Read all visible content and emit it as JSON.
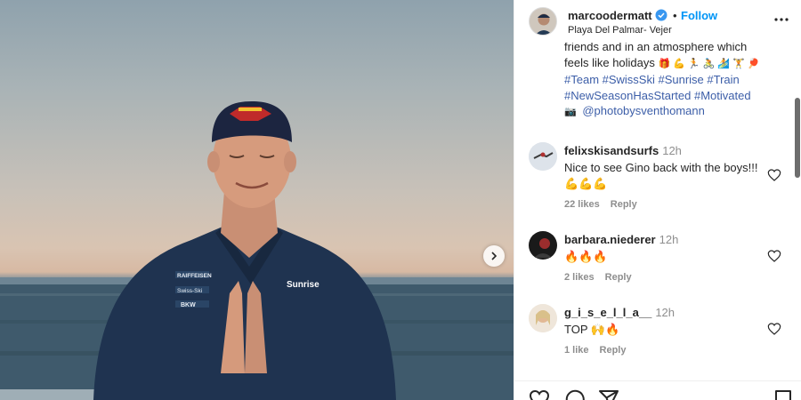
{
  "post": {
    "username": "marcoodermatt",
    "location": "Playa Del Palmar- Vejer",
    "follow_label": "Follow",
    "separator": "•",
    "caption_lines": [
      "friends and in an atmosphere which",
      "feels like holidays"
    ],
    "caption_emojis": [
      "🎁",
      "💪",
      "🏃",
      "🚴",
      "🏄",
      "🏋",
      "🏓"
    ],
    "hashtags_line1": "#Team #SwissSki #Sunrise #Train",
    "hashtags_line2": "#NewSeasonHasStarted #Motivated",
    "photo_credit_icon": "📷",
    "photo_credit": "@photobysventhomann"
  },
  "photo": {
    "jacket_logos": [
      "RAIFFEISEN",
      "Swiss-Ski",
      "BKW"
    ],
    "jacket_brand": "Sunrise",
    "cap_brand": "Red Bull"
  },
  "comments": [
    {
      "username": "felixskisandsurfs",
      "time": "12h",
      "text": "Nice to see Gino back with the boys!!! 💪💪💪",
      "likes": "22 likes",
      "reply": "Reply"
    },
    {
      "username": "barbara.niederer",
      "time": "12h",
      "text": "🔥🔥🔥",
      "likes": "2 likes",
      "reply": "Reply"
    },
    {
      "username": "g_i_s_e_l_l_a__",
      "time": "12h",
      "text": "TOP 🙌🔥",
      "likes": "1 like",
      "reply": "Reply"
    }
  ],
  "icons": {
    "verified": "verified-badge-icon",
    "more": "more-options-icon",
    "next": "chevron-right-icon",
    "heart": "heart-icon",
    "comment": "comment-icon",
    "share": "share-icon",
    "save": "bookmark-icon"
  },
  "colors": {
    "follow": "#0095f6",
    "hashtag": "#3c5ea8",
    "verified": "#3897f0",
    "meta": "#8e8e8e"
  }
}
